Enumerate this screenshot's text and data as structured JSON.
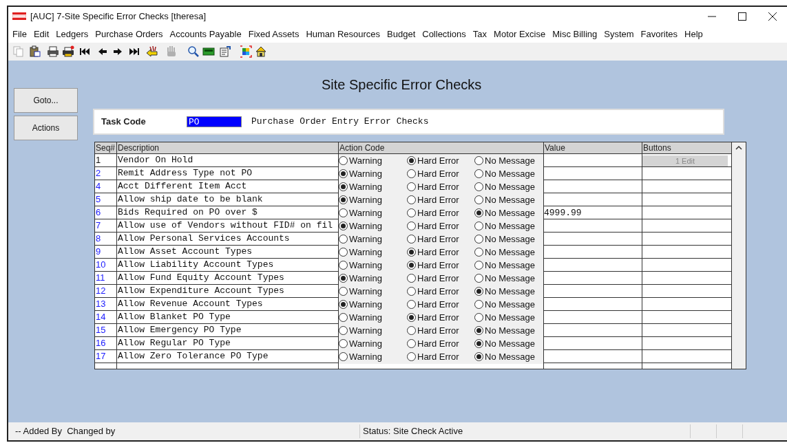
{
  "window": {
    "title": "[AUC] 7-Site Specific Error Checks [theresa]"
  },
  "menu": [
    "File",
    "Edit",
    "Ledgers",
    "Purchase Orders",
    "Accounts Payable",
    "Fixed Assets",
    "Human Resources",
    "Budget",
    "Collections",
    "Tax",
    "Motor Excise",
    "Misc Billing",
    "System",
    "Favorites",
    "Help"
  ],
  "toolbar": [
    {
      "kind": "copy",
      "disabled": true
    },
    {
      "kind": "paste",
      "disabled": false
    },
    {
      "kind": "print",
      "disabled": false
    },
    {
      "kind": "print-red",
      "disabled": false
    },
    {
      "kind": "first",
      "disabled": false
    },
    {
      "kind": "prev",
      "disabled": false
    },
    {
      "kind": "next",
      "disabled": false
    },
    {
      "kind": "last",
      "disabled": false
    },
    {
      "kind": "back-hand",
      "disabled": false
    },
    {
      "kind": "hand",
      "disabled": true
    },
    {
      "kind": "search",
      "disabled": false
    },
    {
      "kind": "calc",
      "disabled": false
    },
    {
      "kind": "form",
      "disabled": false
    },
    {
      "kind": "grid",
      "disabled": false
    },
    {
      "kind": "home",
      "disabled": false
    }
  ],
  "side_buttons": [
    "Goto...",
    "Actions"
  ],
  "heading": "Site Specific Error Checks",
  "task": {
    "label": "Task Code",
    "value": "PO",
    "description": "Purchase Order Entry Error Checks"
  },
  "table": {
    "columns": [
      "Seq#",
      "Description",
      "Action Code",
      "Value",
      "Buttons"
    ],
    "rows": [
      {
        "seq": "1",
        "selected": true,
        "description": "Vendor On Hold",
        "options": [
          {
            "label": "Warning",
            "selected": false
          },
          {
            "label": "Hard Error",
            "selected": true
          },
          {
            "label": "No Message",
            "selected": false
          }
        ],
        "button": "1 Edit"
      },
      {
        "seq": "2",
        "selected": false,
        "description": "Remit Address Type not PO",
        "options": [
          {
            "label": "Warning",
            "selected": true
          },
          {
            "label": "Hard Error",
            "selected": false
          },
          {
            "label": "No Message",
            "selected": false
          }
        ]
      },
      {
        "seq": "4",
        "selected": false,
        "description": "Acct Different Item Acct",
        "options": [
          {
            "label": "Warning",
            "selected": true
          },
          {
            "label": "Hard Error",
            "selected": false
          },
          {
            "label": "No Message",
            "selected": false
          }
        ]
      },
      {
        "seq": "5",
        "selected": false,
        "description": "Allow ship date to be blank",
        "options": [
          {
            "label": "Warning",
            "selected": true
          },
          {
            "label": "Hard Error",
            "selected": false
          },
          {
            "label": "No Message",
            "selected": false
          }
        ]
      },
      {
        "seq": "6",
        "selected": false,
        "description": "Bids Required on PO over $",
        "options": [
          {
            "label": "Warning",
            "selected": false
          },
          {
            "label": "Hard Error",
            "selected": false
          },
          {
            "label": "No Message",
            "selected": true
          }
        ],
        "value": "4999.99"
      },
      {
        "seq": "7",
        "selected": false,
        "description": "Allow use of Vendors without FID# on fil",
        "options": [
          {
            "label": "Warning",
            "selected": true
          },
          {
            "label": "Hard Error",
            "selected": false
          },
          {
            "label": "No Message",
            "selected": false
          }
        ]
      },
      {
        "seq": "8",
        "selected": false,
        "description": "Allow Personal Services Accounts",
        "options": [
          {
            "label": "Warning",
            "selected": false
          },
          {
            "label": "Hard Error",
            "selected": false
          },
          {
            "label": "No Message",
            "selected": false
          }
        ]
      },
      {
        "seq": "9",
        "selected": false,
        "description": "Allow Asset Account Types",
        "options": [
          {
            "label": "Warning",
            "selected": false
          },
          {
            "label": "Hard Error",
            "selected": true
          },
          {
            "label": "No Message",
            "selected": false
          }
        ]
      },
      {
        "seq": "10",
        "selected": false,
        "description": "Allow Liability Account Types",
        "options": [
          {
            "label": "Warning",
            "selected": false
          },
          {
            "label": "Hard Error",
            "selected": true
          },
          {
            "label": "No Message",
            "selected": false
          }
        ]
      },
      {
        "seq": "11",
        "selected": false,
        "description": "Allow Fund Equity Account Types",
        "options": [
          {
            "label": "Warning",
            "selected": true
          },
          {
            "label": "Hard Error",
            "selected": false
          },
          {
            "label": "No Message",
            "selected": false
          }
        ]
      },
      {
        "seq": "12",
        "selected": false,
        "description": "Allow Expenditure Account Types",
        "options": [
          {
            "label": "Warning",
            "selected": false
          },
          {
            "label": "Hard Error",
            "selected": false
          },
          {
            "label": "No Message",
            "selected": true
          }
        ]
      },
      {
        "seq": "13",
        "selected": false,
        "description": "Allow Revenue Account Types",
        "options": [
          {
            "label": "Warning",
            "selected": true
          },
          {
            "label": "Hard Error",
            "selected": false
          },
          {
            "label": "No Message",
            "selected": false
          }
        ]
      },
      {
        "seq": "14",
        "selected": false,
        "description": "Allow Blanket PO Type",
        "options": [
          {
            "label": "Warning",
            "selected": false
          },
          {
            "label": "Hard Error",
            "selected": true
          },
          {
            "label": "No Message",
            "selected": false
          }
        ]
      },
      {
        "seq": "15",
        "selected": false,
        "description": "Allow Emergency PO Type",
        "options": [
          {
            "label": "Warning",
            "selected": false
          },
          {
            "label": "Hard Error",
            "selected": false
          },
          {
            "label": "No Message",
            "selected": true
          }
        ]
      },
      {
        "seq": "16",
        "selected": false,
        "description": "Allow Regular PO Type",
        "options": [
          {
            "label": "Warning",
            "selected": false
          },
          {
            "label": "Hard Error",
            "selected": false
          },
          {
            "label": "No Message",
            "selected": true
          }
        ]
      },
      {
        "seq": "17",
        "selected": false,
        "description": "Allow Zero Tolerance PO Type",
        "options": [
          {
            "label": "Warning",
            "selected": false
          },
          {
            "label": "Hard Error",
            "selected": false
          },
          {
            "label": "No Message",
            "selected": true
          }
        ]
      }
    ]
  },
  "status_bar": {
    "left": "-- Added By  Changed by",
    "status": "Status: Site Check Active"
  }
}
